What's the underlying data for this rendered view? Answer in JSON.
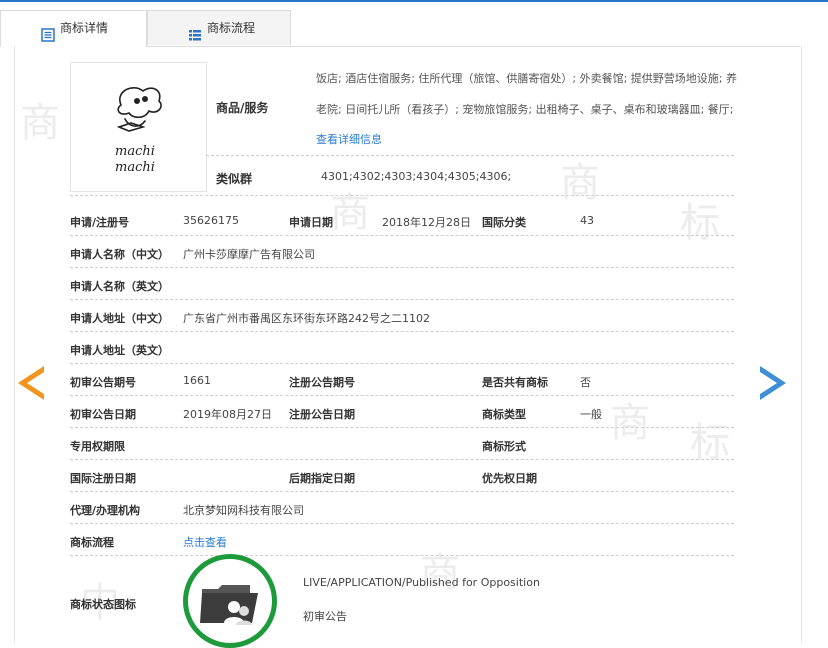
{
  "tabs": [
    {
      "label": "商标详情",
      "active": true
    },
    {
      "label": "商标流程",
      "active": false
    }
  ],
  "logo": {
    "text_line1": "machi",
    "text_line2": "machi"
  },
  "goods": {
    "label": "商品/服务",
    "line1": "饭店; 酒店住宿服务; 住所代理（旅馆、供膳寄宿处）; 外卖餐馆; 提供野营场地设施; 养",
    "line2": "老院; 日间托儿所（看孩子）; 宠物旅馆服务; 出租椅子、桌子、桌布和玻璃器皿; 餐厅;",
    "detail_link": "查看详细信息"
  },
  "similar": {
    "label": "类似群",
    "value": "4301;4302;4303;4304;4305;4306;"
  },
  "rows": [
    {
      "cells": [
        {
          "label": "申请/注册号",
          "value": "35626175"
        },
        {
          "label": "申请日期",
          "value": "2018年12月28日"
        },
        {
          "label": "国际分类",
          "value": "43"
        }
      ]
    },
    {
      "cells": [
        {
          "label": "申请人名称（中文）",
          "value": "广州卡莎摩摩广告有限公司"
        }
      ]
    },
    {
      "cells": [
        {
          "label": "申请人名称（英文）",
          "value": ""
        }
      ]
    },
    {
      "cells": [
        {
          "label": "申请人地址（中文）",
          "value": "广东省广州市番禺区东环街东环路242号之二1102"
        }
      ]
    },
    {
      "cells": [
        {
          "label": "申请人地址（英文）",
          "value": ""
        }
      ]
    },
    {
      "cells": [
        {
          "label": "初审公告期号",
          "value": "1661"
        },
        {
          "label": "注册公告期号",
          "value": ""
        },
        {
          "label": "是否共有商标",
          "value": "否"
        }
      ]
    },
    {
      "cells": [
        {
          "label": "初审公告日期",
          "value": "2019年08月27日"
        },
        {
          "label": "注册公告日期",
          "value": ""
        },
        {
          "label": "商标类型",
          "value": "一般"
        }
      ]
    },
    {
      "cells": [
        {
          "label": "专用权期限",
          "value": ""
        },
        {
          "label": "",
          "value": ""
        },
        {
          "label": "商标形式",
          "value": ""
        }
      ]
    },
    {
      "cells": [
        {
          "label": "国际注册日期",
          "value": ""
        },
        {
          "label": "后期指定日期",
          "value": ""
        },
        {
          "label": "优先权日期",
          "value": ""
        }
      ]
    },
    {
      "cells": [
        {
          "label": "代理/办理机构",
          "value": "北京梦知网科技有限公司"
        }
      ]
    },
    {
      "cells": [
        {
          "label": "商标流程",
          "value": "点击查看"
        }
      ]
    }
  ],
  "status": {
    "label": "商标状态图标",
    "english": "LIVE/APPLICATION/Published for Opposition",
    "chinese": "初审公告"
  },
  "colors": {
    "accent": "#2c73c9",
    "link": "#2a7bd1",
    "prev_arrow": "#f1951f",
    "next_arrow": "#3f8fd6",
    "status_ring": "#1d9a3b"
  }
}
